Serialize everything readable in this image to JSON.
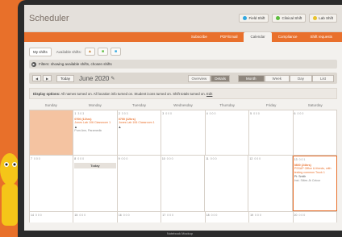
{
  "app": {
    "title": "Scheduler"
  },
  "header_buttons": [
    {
      "label": "Field Shift",
      "color": "#2fa7e0"
    },
    {
      "label": "Clinical Shift",
      "color": "#5bbd3c"
    },
    {
      "label": "Lab Shift",
      "color": "#e8c22b"
    }
  ],
  "nav": {
    "items": [
      {
        "label": "Subscribe"
      },
      {
        "label": "PDF/Email"
      },
      {
        "label": "Calendar"
      },
      {
        "label": "Compliance"
      },
      {
        "label": "Shift requests"
      }
    ],
    "active": "Calendar"
  },
  "shifts_bar": {
    "my_shifts": "My shifts",
    "available_label": "Available shifts:"
  },
  "filter": {
    "text": "Filters: showing available shifts, chosen shifts"
  },
  "calendar_nav": {
    "today": "Today",
    "month": "June 2020",
    "view_modes": [
      "Overview",
      "Details"
    ],
    "active_view": "Details",
    "ranges": [
      "Month",
      "Week",
      "Day",
      "List"
    ],
    "active_range": "Month"
  },
  "display_options": {
    "label": "Display options:",
    "text": "All names turned on. All location info turned on. Student icons turned on. Shift totals turned on.",
    "edit": "Edit"
  },
  "days_of_week": [
    "Sunday",
    "Monday",
    "Tuesday",
    "Wednesday",
    "Thursday",
    "Friday",
    "Saturday"
  ],
  "weeks": [
    {
      "days": [
        {
          "num": "",
          "past": true
        },
        {
          "num": "1",
          "icons": "3 0 3",
          "shift": {
            "time": "0700 (12hrs)",
            "desc": "Jones Lab 106 Classroom 1",
            "person": "",
            "meta": "Pum Ann, Paramedic"
          }
        },
        {
          "num": "2",
          "icons": "3 0 3",
          "shift": {
            "time": "0700 (12hrs)",
            "desc": "Jones Lab 106 Classroom 1",
            "person": "",
            "meta": ""
          }
        },
        {
          "num": "3",
          "icons": "0 0 0"
        },
        {
          "num": "4",
          "icons": "0 0 0"
        },
        {
          "num": "5",
          "icons": "0 0 0"
        },
        {
          "num": "6",
          "icons": "0 0 0"
        }
      ]
    },
    {
      "days": [
        {
          "num": "7",
          "icons": "0 0 0"
        },
        {
          "num": "8",
          "icons": "0 0 0",
          "today": "Today"
        },
        {
          "num": "9",
          "icons": "0 0 0"
        },
        {
          "num": "10",
          "icons": "0 0 0"
        },
        {
          "num": "11",
          "icons": "0 0 0"
        },
        {
          "num": "12",
          "icons": "0 0 0"
        },
        {
          "num": "13",
          "icons": "0 0 1",
          "highlight": true,
          "shift": {
            "time": "0800 (24hrs)",
            "desc": "PSSAP Office & friends, with testing common Truck 1",
            "person": "Pt: Smith",
            "meta": "Inst: Stiles Jk Celcur"
          }
        }
      ]
    },
    {
      "days": [
        {
          "num": "14",
          "icons": "0 0 0"
        },
        {
          "num": "15",
          "icons": "0 0 0"
        },
        {
          "num": "16",
          "icons": "0 0 0"
        },
        {
          "num": "17",
          "icons": "0 0 0"
        },
        {
          "num": "18",
          "icons": "0 0 0"
        },
        {
          "num": "19",
          "icons": "0 0 0"
        },
        {
          "num": "20",
          "icons": "0 0 0"
        }
      ]
    }
  ],
  "laptop": {
    "label": "Notebook Mockup"
  }
}
